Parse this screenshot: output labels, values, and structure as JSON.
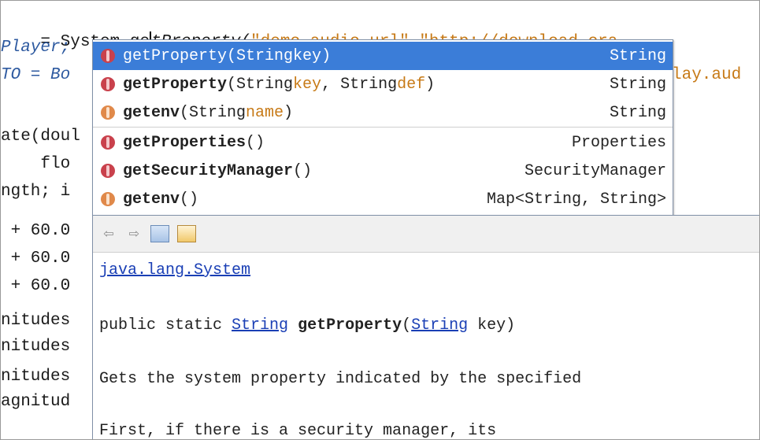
{
  "editor": {
    "lines": [
      {
        "left": {
          "pre": "= System.ge",
          "post": "tProperty(",
          "str1": "\"demo.audio.url\"",
          "comma": ",",
          "str2": "\"http://download.ora"
        }
      },
      {
        "left_text": "Player;"
      },
      {
        "left_text": "TO = Bo",
        "right_text": "lay.aud"
      },
      {
        "left_text": ""
      },
      {
        "left_text": "ate(doul"
      },
      {
        "left_text": "    flo"
      },
      {
        "left_text": "ngth; i"
      },
      {
        "left_text": " + 60.0"
      },
      {
        "left_text": " + 60.0"
      },
      {
        "left_text": " + 60.0"
      },
      {
        "left_text": "nitudes"
      },
      {
        "left_text": "nitudes"
      },
      {
        "left_text": "nitudes"
      },
      {
        "left_text": "agnitud"
      }
    ]
  },
  "completion": {
    "items": [
      {
        "name": "getProperty",
        "args_open": "(String ",
        "arg1": "key",
        "args_mid": "",
        "arg2": "",
        "args_close": ")",
        "ret": "String",
        "selected": true
      },
      {
        "name": "getProperty",
        "args_open": "(String ",
        "arg1": "key",
        "args_mid": ", String ",
        "arg2": "def",
        "args_close": ")",
        "ret": "String",
        "selected": false
      },
      {
        "name": "getenv",
        "args_open": "(String ",
        "arg1": "name",
        "args_mid": "",
        "arg2": "",
        "args_close": ")",
        "ret": "String",
        "selected": false
      },
      {
        "name": "getProperties",
        "args_open": "()",
        "arg1": "",
        "args_mid": "",
        "arg2": "",
        "args_close": "",
        "ret": "Properties",
        "selected": false
      },
      {
        "name": "getSecurityManager",
        "args_open": "()",
        "arg1": "",
        "args_mid": "",
        "arg2": "",
        "args_close": "",
        "ret": "SecurityManager",
        "selected": false
      },
      {
        "name": "getenv",
        "args_open": "()",
        "arg1": "",
        "args_mid": "",
        "arg2": "",
        "args_close": "",
        "ret": "Map<String, String>",
        "selected": false
      }
    ]
  },
  "javadoc": {
    "toolbar": {
      "back": "back-arrow",
      "forward": "forward-arrow",
      "open_browser": "browser-icon",
      "source": "source-icon"
    },
    "class_link": "java.lang.System",
    "sig_pre": "public static ",
    "sig_type": "String",
    "sig_space": " ",
    "sig_name": "getProperty",
    "sig_open": "(",
    "sig_param_type": "String",
    "sig_param": " key)",
    "desc": "Gets the system property indicated by the specified",
    "desc2": "First, if there is a security manager, its"
  },
  "colors": {
    "selection": "#3b7dd8",
    "string": "#c77a17",
    "link": "#1a3fb5"
  }
}
